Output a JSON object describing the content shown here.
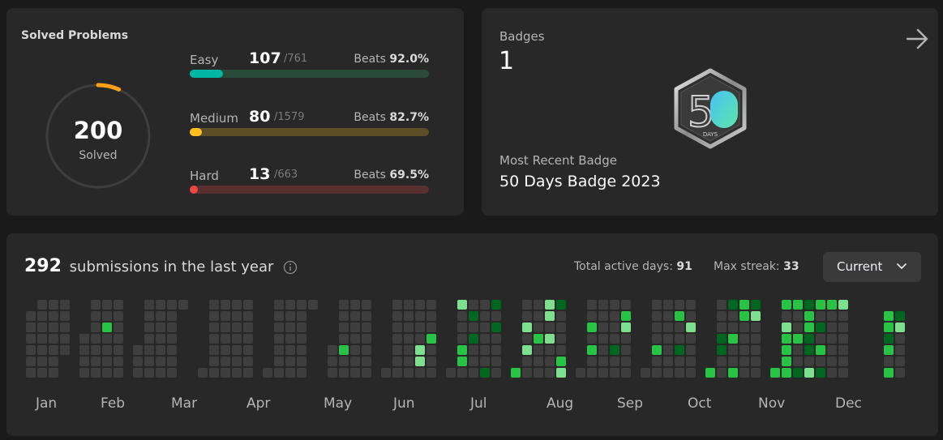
{
  "solved": {
    "title": "Solved Problems",
    "count": "200",
    "count_label": "Solved",
    "total_solved": 200,
    "total_problems": 3003,
    "ring_color": "#ffa116",
    "difficulties": [
      {
        "name": "Easy",
        "solved": "107",
        "total": "/761",
        "beats_label": "Beats",
        "beats": "92.0%",
        "solved_num": 107,
        "total_num": 761,
        "color": "#00b8a3",
        "track": "#2a4b3a"
      },
      {
        "name": "Medium",
        "solved": "80",
        "total": "/1579",
        "beats_label": "Beats",
        "beats": "82.7%",
        "solved_num": 80,
        "total_num": 1579,
        "color": "#ffc01e",
        "track": "#5e4e27"
      },
      {
        "name": "Hard",
        "solved": "13",
        "total": "/663",
        "beats_label": "Beats",
        "beats": "69.5%",
        "solved_num": 13,
        "total_num": 663,
        "color": "#ef4743",
        "track": "#5a2f2f"
      }
    ]
  },
  "badges": {
    "label": "Badges",
    "count": "1",
    "arrow_icon": "arrow-right-icon",
    "badge_icon": "fifty-days-badge-icon",
    "badge_text": "50",
    "badge_caption": "DAYS",
    "recent_label": "Most Recent Badge",
    "recent_name": "50 Days Badge 2023"
  },
  "submissions": {
    "count": "292",
    "title": "submissions in the last year",
    "info_icon": "info-icon",
    "active_days_label": "Total active days:",
    "active_days": "91",
    "max_streak_label": "Max streak:",
    "max_streak": "33",
    "year_select": "Current",
    "colors": {
      "empty": "#3e3e3e",
      "l1": "#016620",
      "l2": "#28c244",
      "l3": "#7ee08f"
    },
    "months": [
      "Jan",
      "Feb",
      "Mar",
      "Apr",
      "May",
      "Jun",
      "Jul",
      "Aug",
      "Sep",
      "Oct",
      "Nov",
      "Dec"
    ],
    "weeks": [
      [
        -1,
        0,
        0,
        0,
        0,
        0,
        0
      ],
      [
        0,
        0,
        0,
        0,
        0,
        0,
        0
      ],
      [
        0,
        0,
        0,
        0,
        0,
        0,
        0
      ],
      [
        0,
        0,
        0,
        0,
        0,
        -1,
        -1
      ],
      [
        -1,
        -1,
        -1,
        0,
        0,
        0,
        0
      ],
      [
        0,
        0,
        0,
        0,
        0,
        0,
        0
      ],
      [
        0,
        0,
        2,
        0,
        0,
        0,
        0
      ],
      [
        0,
        0,
        0,
        0,
        0,
        0,
        0
      ],
      [
        -1,
        -1,
        -1,
        -1,
        0,
        0,
        0
      ],
      [
        0,
        0,
        0,
        0,
        0,
        0,
        0
      ],
      [
        0,
        0,
        0,
        0,
        0,
        0,
        0
      ],
      [
        0,
        0,
        0,
        0,
        0,
        0,
        0
      ],
      [
        0,
        -1,
        -1,
        -1,
        -1,
        -1,
        -1
      ],
      [
        -1,
        -1,
        -1,
        -1,
        -1,
        -1,
        0
      ],
      [
        0,
        0,
        0,
        0,
        0,
        0,
        0
      ],
      [
        0,
        0,
        0,
        0,
        0,
        0,
        0
      ],
      [
        0,
        0,
        0,
        0,
        0,
        0,
        0
      ],
      [
        0,
        0,
        0,
        0,
        0,
        0,
        0
      ],
      [
        -1,
        -1,
        -1,
        -1,
        -1,
        -1,
        0
      ],
      [
        0,
        0,
        0,
        0,
        0,
        0,
        0
      ],
      [
        0,
        0,
        0,
        0,
        0,
        0,
        0
      ],
      [
        0,
        0,
        0,
        0,
        0,
        0,
        0
      ],
      [
        0,
        -1,
        -1,
        -1,
        -1,
        -1,
        -1
      ],
      [
        -1,
        -1,
        -1,
        -1,
        0,
        0,
        0
      ],
      [
        0,
        0,
        0,
        0,
        2,
        0,
        0
      ],
      [
        0,
        0,
        0,
        0,
        0,
        0,
        0
      ],
      [
        0,
        0,
        0,
        0,
        0,
        0,
        0
      ],
      [
        -1,
        -1,
        -1,
        -1,
        -1,
        -1,
        0
      ],
      [
        0,
        0,
        0,
        0,
        0,
        0,
        0
      ],
      [
        0,
        0,
        0,
        0,
        0,
        0,
        0
      ],
      [
        0,
        0,
        0,
        0,
        3,
        3,
        0
      ],
      [
        0,
        0,
        0,
        2,
        0,
        0,
        0
      ],
      [
        -1,
        -1,
        -1,
        -1,
        -1,
        -1,
        0
      ],
      [
        3,
        0,
        0,
        0,
        2,
        2,
        0
      ],
      [
        0,
        1,
        0,
        1,
        0,
        0,
        0
      ],
      [
        0,
        0,
        0,
        0,
        0,
        0,
        1
      ],
      [
        1,
        0,
        1,
        0,
        0,
        0,
        0
      ],
      [
        -1,
        -1,
        -1,
        -1,
        -1,
        -1,
        2
      ],
      [
        0,
        0,
        3,
        0,
        3,
        0,
        0
      ],
      [
        0,
        0,
        0,
        2,
        0,
        0,
        0
      ],
      [
        3,
        3,
        0,
        3,
        0,
        0,
        0
      ],
      [
        1,
        0,
        0,
        0,
        0,
        2,
        3
      ],
      [
        -1,
        -1,
        -1,
        -1,
        -1,
        -1,
        0
      ],
      [
        0,
        0,
        2,
        0,
        2,
        0,
        0
      ],
      [
        0,
        0,
        0,
        0,
        0,
        0,
        0
      ],
      [
        0,
        0,
        0,
        0,
        1,
        0,
        0
      ],
      [
        0,
        2,
        3,
        0,
        0,
        0,
        0
      ],
      [
        -1,
        -1,
        -1,
        -1,
        -1,
        -1,
        0
      ],
      [
        0,
        0,
        0,
        0,
        2,
        0,
        0
      ],
      [
        0,
        0,
        0,
        0,
        0,
        0,
        0
      ],
      [
        0,
        2,
        0,
        0,
        1,
        0,
        0
      ],
      [
        0,
        0,
        3,
        0,
        0,
        0,
        0
      ],
      [
        -1,
        -1,
        -1,
        -1,
        -1,
        -1,
        2
      ],
      [
        0,
        0,
        0,
        1,
        1,
        0,
        0
      ],
      [
        1,
        0,
        0,
        2,
        0,
        0,
        2
      ],
      [
        2,
        2,
        0,
        0,
        0,
        0,
        0
      ],
      [
        1,
        3,
        0,
        0,
        0,
        0,
        0
      ],
      [
        -1,
        -1,
        -1,
        -1,
        -1,
        -1,
        2
      ],
      [
        2,
        0,
        3,
        2,
        2,
        2,
        2
      ],
      [
        2,
        0,
        0,
        2,
        0,
        0,
        1
      ],
      [
        1,
        2,
        2,
        1,
        1,
        0,
        3
      ],
      [
        2,
        0,
        1,
        0,
        2,
        0,
        1
      ],
      [
        2,
        0,
        0,
        0,
        0,
        0,
        0
      ],
      [
        3,
        0,
        0,
        0,
        0,
        0,
        0
      ],
      [
        -1,
        -1,
        -1,
        -1,
        -1,
        -1,
        -1
      ],
      [
        -1,
        -1,
        -1,
        -1,
        -1,
        -1,
        -1
      ],
      [
        -1,
        -1,
        -1,
        -1,
        -1,
        -1,
        -1
      ],
      [
        -1,
        2,
        2,
        1,
        2,
        0,
        2
      ],
      [
        -1,
        1,
        3,
        0,
        0,
        0,
        0
      ]
    ]
  }
}
